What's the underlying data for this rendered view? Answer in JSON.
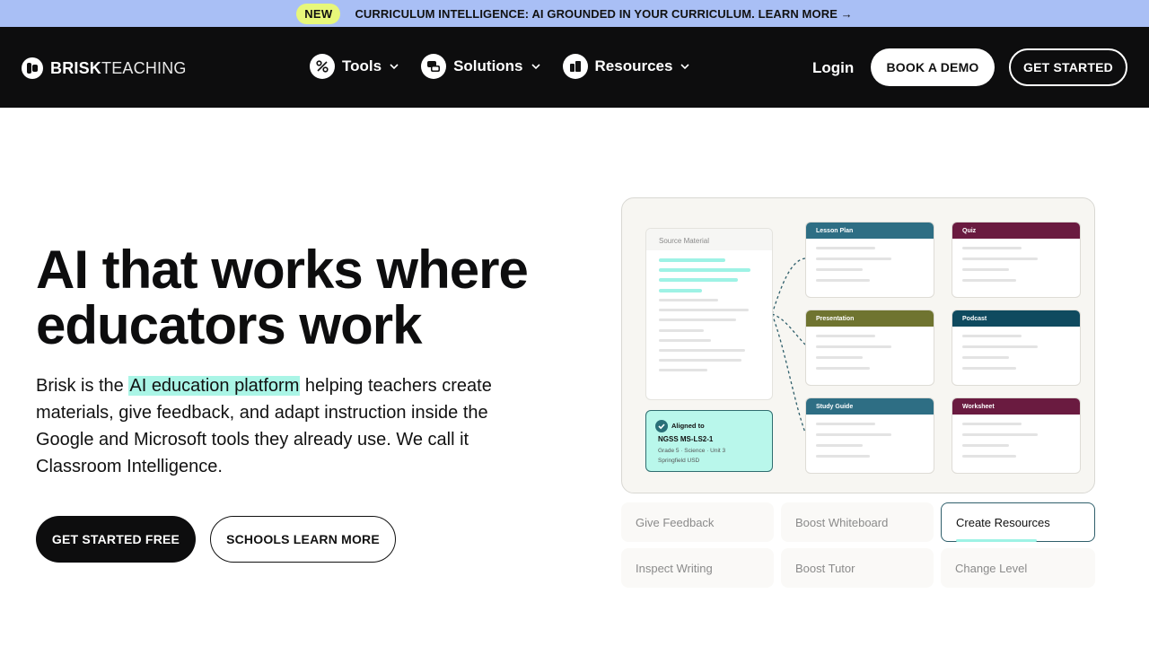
{
  "announcement": {
    "badge": "NEW",
    "message": "CURRICULUM INTELLIGENCE: AI GROUNDED IN YOUR CURRICULUM. LEARN MORE →"
  },
  "nav": {
    "logo_bold": "BRISK",
    "logo_light": "TEACHING",
    "items": [
      {
        "label": "Tools",
        "icon": "percent-badge-icon"
      },
      {
        "label": "Solutions",
        "icon": "chat-bubbles-icon"
      },
      {
        "label": "Resources",
        "icon": "book-icon"
      }
    ],
    "login": "Login",
    "book_demo": "BOOK A DEMO",
    "get_started": "GET STARTED"
  },
  "hero": {
    "title_line1": "AI that works where",
    "title_line2": "educators work",
    "sub_prefix": "Brisk is the ",
    "sub_highlight": "AI education platform",
    "sub_suffix": " helping teachers create materials, give feedback, and adapt instruction inside the Google and Microsoft tools they already use. We call it Classroom Intelligence.",
    "cta_primary": "GET STARTED FREE",
    "cta_secondary": "SCHOOLS LEARN MORE"
  },
  "demo": {
    "source_label": "Source Material",
    "aligned": {
      "title": "Aligned to",
      "standard": "NGSS MS-LS2-1",
      "meta": "Grade 5 · Science · Unit 3",
      "district": "Springfield USD"
    },
    "resources": [
      {
        "label": "Lesson Plan",
        "color": "#2e6e84"
      },
      {
        "label": "Quiz",
        "color": "#6a1b40"
      },
      {
        "label": "Presentation",
        "color": "#6f7430"
      },
      {
        "label": "Podcast",
        "color": "#0f4a5f"
      },
      {
        "label": "Study Guide",
        "color": "#2e6e84"
      },
      {
        "label": "Worksheet",
        "color": "#6a1b40"
      }
    ]
  },
  "tabs": [
    {
      "label": "Give Feedback",
      "active": false
    },
    {
      "label": "Boost Whiteboard",
      "active": false
    },
    {
      "label": "Create Resources",
      "active": true
    },
    {
      "label": "Inspect Writing",
      "active": false
    },
    {
      "label": "Boost Tutor",
      "active": false
    },
    {
      "label": "Change Level",
      "active": false
    }
  ],
  "colors": {
    "announce_bg": "#a9bff5",
    "badge_bg": "#e7f77a",
    "nav_bg": "#0d0d0e",
    "highlight": "#aaf5e6"
  }
}
